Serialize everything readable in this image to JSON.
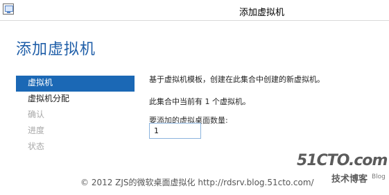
{
  "window": {
    "title": "添加虚拟机",
    "icon": "server-manager-icon"
  },
  "page": {
    "title": "添加虚拟机"
  },
  "nav": {
    "items": [
      {
        "label": "虚拟机",
        "state": "active"
      },
      {
        "label": "虚拟机分配",
        "state": "normal"
      },
      {
        "label": "确认",
        "state": "disabled"
      },
      {
        "label": "进度",
        "state": "disabled"
      },
      {
        "label": "状态",
        "state": "disabled"
      }
    ]
  },
  "content": {
    "description": "基于虚拟机模板，创建在此集合中创建的新虚拟机。",
    "current_count": "此集合中当前有 1 个虚拟机。",
    "input_label": "要添加的虚拟桌面数量:",
    "input_value": "1"
  },
  "watermark": {
    "text": "© 2012 ZJS的微软桌面虚拟化 http://rdsrv.blog.51cto.com/",
    "logo_main": "51CTO.com",
    "logo_sub": "技术博客",
    "logo_blog": "Blog"
  },
  "colors": {
    "accent": "#1b68b5",
    "title": "#1f5ea8",
    "disabled": "#a9a9a9"
  }
}
